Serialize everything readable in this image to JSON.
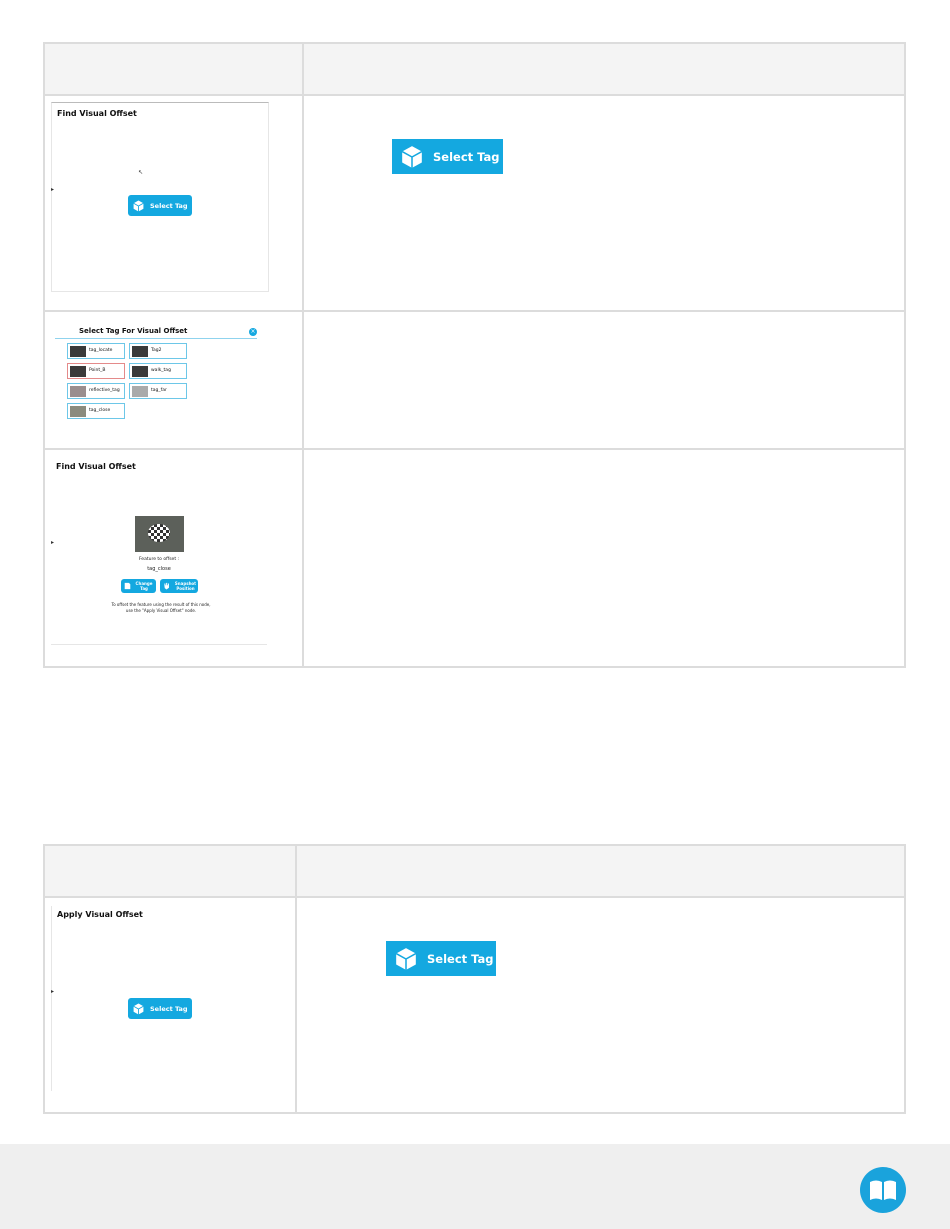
{
  "table1": {
    "row1": {
      "title": "Find Visual Offset",
      "button_label": "Select Tag",
      "big_button_label": "Select Tag"
    },
    "row2": {
      "dialog_title": "Select Tag For Visual Offset",
      "tags": [
        "tag_locate",
        "Tag2",
        "Point_B",
        "walk_tag",
        "reflective_tag",
        "tag_far",
        "tag_close"
      ]
    },
    "row3": {
      "title": "Find Visual Offset",
      "feature_label": "Feature to offset :",
      "feature_name": "tag_close",
      "change_tag": "Change Tag",
      "snapshot_position": "Snapshot Position",
      "note": "To offset the feature using the result of this node, use the \"Apply Visual Offset\" node."
    }
  },
  "table2": {
    "row1": {
      "title": "Apply Visual Offset",
      "button_label": "Select Tag",
      "big_button_label": "Select Tag"
    }
  },
  "colors": {
    "accent": "#14a8e0",
    "border": "#dcdcdc",
    "header_bg": "#f4f4f4"
  },
  "footer": {
    "icon": "book-icon"
  }
}
